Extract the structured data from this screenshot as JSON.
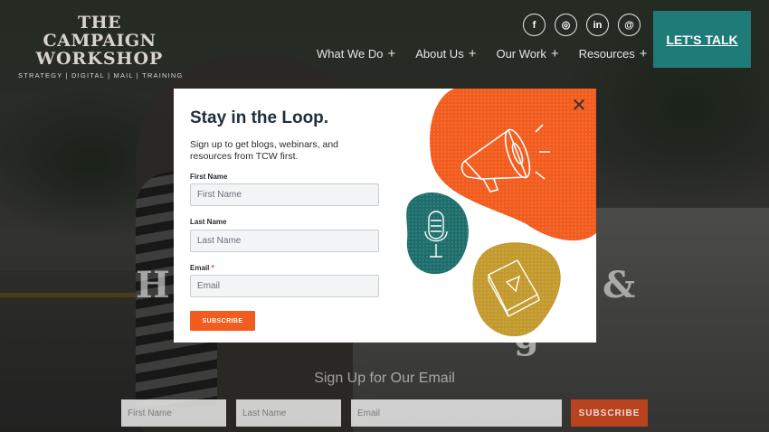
{
  "header": {
    "logo_line1": "THE CAMPAIGN",
    "logo_line2": "WORKSHOP",
    "logo_tagline": "STRATEGY | DIGITAL | MAIL | TRAINING",
    "socials": [
      {
        "name": "facebook-icon",
        "glyph": "f"
      },
      {
        "name": "instagram-icon",
        "glyph": "◎"
      },
      {
        "name": "linkedin-icon",
        "glyph": "in"
      },
      {
        "name": "threads-icon",
        "glyph": "@"
      }
    ],
    "nav": [
      {
        "label": "What We Do"
      },
      {
        "label": "About Us"
      },
      {
        "label": "Our Work"
      },
      {
        "label": "Resources"
      }
    ],
    "nav_plus": "+",
    "cta_label": "LET'S TALK"
  },
  "hero": {
    "word_left": "H",
    "word_right": "&",
    "word_bottom": "g"
  },
  "email_bar": {
    "title": "Sign Up for Our Email",
    "first_name_placeholder": "First Name",
    "last_name_placeholder": "Last Name",
    "email_placeholder": "Email",
    "button_label": "SUBSCRIBE"
  },
  "modal": {
    "title": "Stay in the Loop.",
    "description": "Sign up to get blogs, webinars, and resources from TCW first.",
    "first_name_label": "First Name",
    "first_name_placeholder": "First Name",
    "last_name_label": "Last Name",
    "last_name_placeholder": "Last Name",
    "email_label": "Email",
    "required_mark": "*",
    "email_placeholder": "Email",
    "subscribe_label": "SUBSCRIBE",
    "close_glyph": "✕"
  },
  "colors": {
    "teal": "#1e7b78",
    "orange": "#f25c1e",
    "mustard": "#c39a2e",
    "dark_teal": "#1e6f6c"
  }
}
